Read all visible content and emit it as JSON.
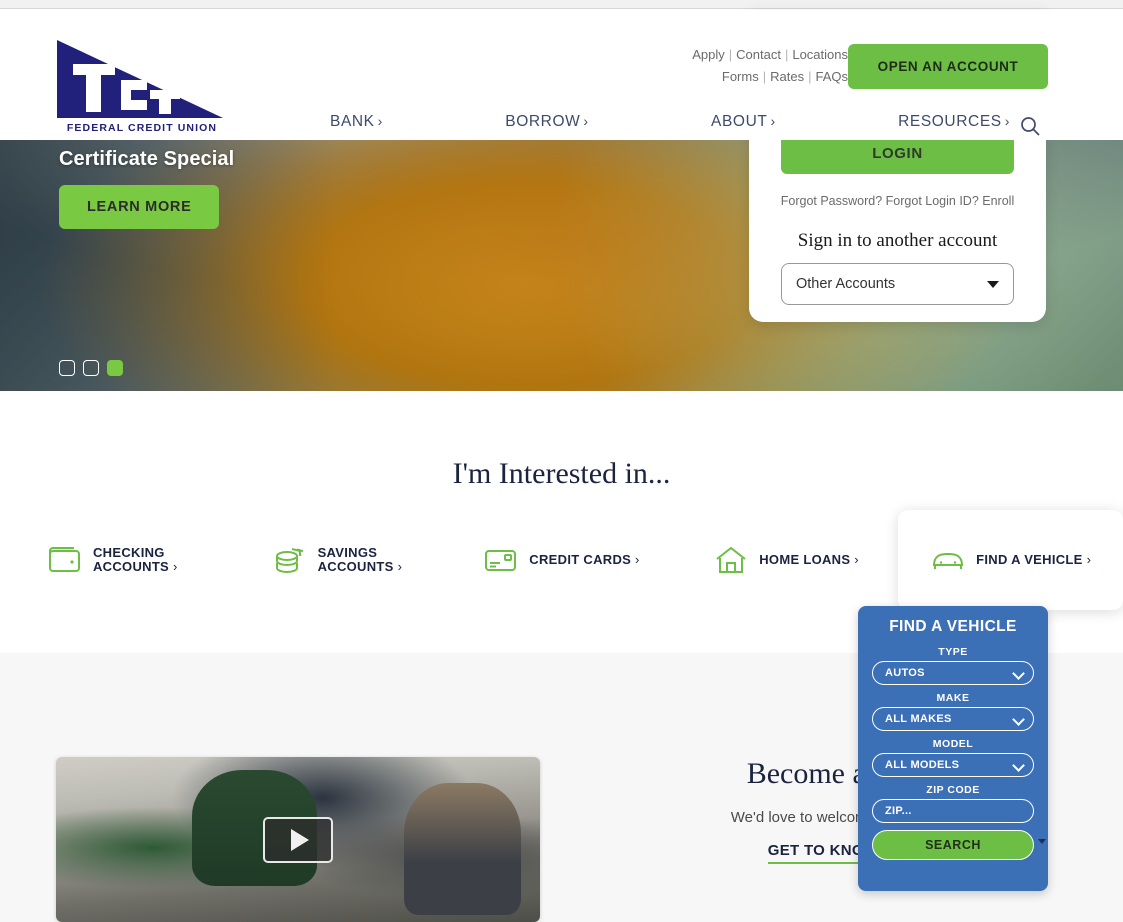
{
  "header": {
    "logo": {
      "mark_text": "TCT",
      "subtitle": "FEDERAL CREDIT UNION"
    },
    "utility_links_row1": [
      {
        "label": "Apply"
      },
      {
        "label": "Contact"
      },
      {
        "label": "Locations"
      }
    ],
    "utility_links_row2": [
      {
        "label": "Forms"
      },
      {
        "label": "Rates"
      },
      {
        "label": "FAQs"
      }
    ],
    "separator": "|",
    "open_account_label": "OPEN AN ACCOUNT",
    "nav": [
      {
        "label": "BANK",
        "chevron": "›"
      },
      {
        "label": "BORROW",
        "chevron": "›"
      },
      {
        "label": "ABOUT",
        "chevron": "›"
      },
      {
        "label": "RESOURCES",
        "chevron": "›"
      }
    ],
    "search_icon": "search-icon"
  },
  "hero": {
    "slide_title": "Certificate Special",
    "cta_label": "LEARN MORE",
    "dots": [
      {
        "active": false
      },
      {
        "active": false
      },
      {
        "active": true
      }
    ]
  },
  "login": {
    "login_button_label": "LOGIN",
    "forgot_password": "Forgot Password?",
    "forgot_login_id": "Forgot Login ID?",
    "enroll": "Enroll",
    "another_account_heading": "Sign in to another account",
    "account_select_value": "Other Accounts"
  },
  "interested": {
    "heading": "I'm Interested in...",
    "tiles": [
      {
        "label_line1": "CHECKING",
        "label_line2": "ACCOUNTS",
        "chevron": "›",
        "icon": "wallet-icon"
      },
      {
        "label_line1": "SAVINGS",
        "label_line2": "ACCOUNTS",
        "chevron": "›",
        "icon": "coins-icon"
      },
      {
        "label_line1": "CREDIT CARDS",
        "label_line2": "",
        "chevron": "›",
        "icon": "credit-card-icon"
      },
      {
        "label_line1": "HOME LOANS",
        "label_line2": "",
        "chevron": "›",
        "icon": "house-icon"
      },
      {
        "label_line1": "FIND A VEHICLE",
        "label_line2": "",
        "chevron": "›",
        "icon": "car-icon"
      }
    ]
  },
  "find_vehicle": {
    "title": "FIND A VEHICLE",
    "type_label": "TYPE",
    "type_value": "AUTOS",
    "make_label": "MAKE",
    "make_value": "ALL MAKES",
    "model_label": "MODEL",
    "model_value": "ALL MODELS",
    "zip_label": "ZIP CODE",
    "zip_placeholder": "ZIP...",
    "zip_value": "",
    "search_label": "SEARCH"
  },
  "member": {
    "heading": "Become a Me",
    "body": "We'd love to welcome you to t",
    "link_label": "GET TO KNOW T",
    "play_icon": "play-icon"
  },
  "colors": {
    "brand_navy": "#1b2340",
    "logo_blue": "#21207a",
    "accent_green": "#6cbe45",
    "hero_green": "#7ac943",
    "panel_blue": "#3b6fb6",
    "icon_green": "#6cbe45",
    "section_gray": "#f7f7f7"
  }
}
